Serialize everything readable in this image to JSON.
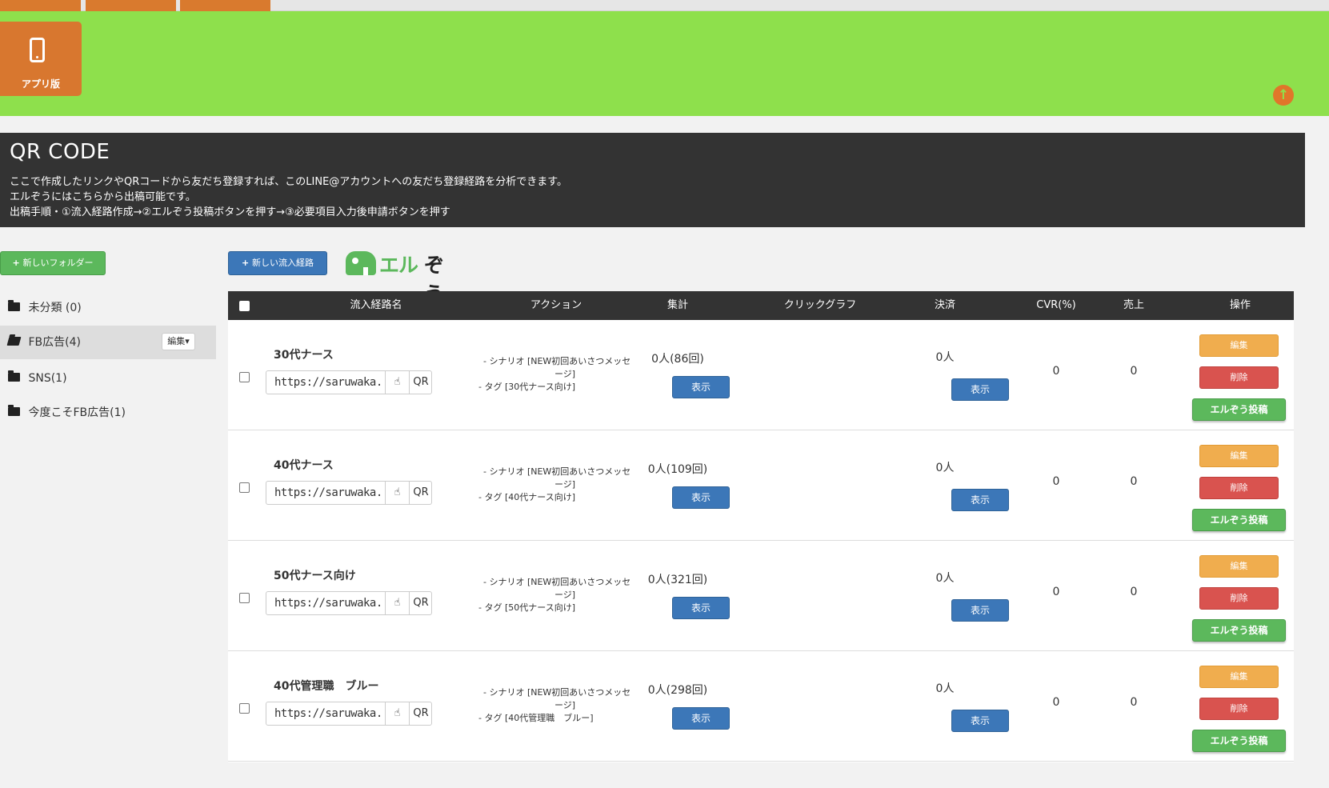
{
  "app": {
    "app_button_label": "アプリ版",
    "icons": {
      "phone": "phone-icon",
      "up": "arrow-up-circle-icon",
      "plus": "plus-icon",
      "folder": "folder-icon",
      "copy": "hand-pointer-icon"
    }
  },
  "header": {
    "title": "QR CODE",
    "desc1": "ここで作成したリンクやQRコードから友だち登録すれば、このLINE@アカウントへの友だち登録経路を分析できます。",
    "desc2": "エルぞうにはこちらから出稿可能です。",
    "desc3": "出稿手順・①流入経路作成→②エルぞう投稿ボタンを押す→③必要項目入力後申請ボタンを押す"
  },
  "sidebar": {
    "new_folder": "新しいフォルダー",
    "folders": [
      {
        "label": "未分類 (0)"
      },
      {
        "label": "FB広告(4)",
        "edit": "編集▾"
      },
      {
        "label": "SNS(1)"
      },
      {
        "label": "今度こそFB広告(1)"
      }
    ]
  },
  "toolbar": {
    "new_route": "新しい流入経路",
    "logo_part1": "エル",
    "logo_part2": "ぞう"
  },
  "table": {
    "columns": [
      "流入経路名",
      "アクション",
      "集計",
      "クリックグラフ",
      "決済",
      "CVR(%)",
      "売上",
      "操作"
    ],
    "url_value": "https://saruwaka.jp",
    "qr_label": "QR",
    "show_label": "表示",
    "edit_label": "編集",
    "delete_label": "削除",
    "post_label": "エルぞう投稿",
    "rows": [
      {
        "name": "30代ナース",
        "scenario_a": "- シナリオ [NEW初回あいさつメッセ",
        "scenario_b": "ージ]",
        "tag": "- タグ [30代ナース向け]",
        "count": "0人(86回)",
        "pay": "0人",
        "cvr": "0",
        "sales": "0"
      },
      {
        "name": "40代ナース",
        "scenario_a": "- シナリオ [NEW初回あいさつメッセ",
        "scenario_b": "ージ]",
        "tag": "- タグ [40代ナース向け]",
        "count": "0人(109回)",
        "pay": "0人",
        "cvr": "0",
        "sales": "0"
      },
      {
        "name": "50代ナース向け",
        "scenario_a": "- シナリオ [NEW初回あいさつメッセ",
        "scenario_b": "ージ]",
        "tag": "- タグ [50代ナース向け]",
        "count": "0人(321回)",
        "pay": "0人",
        "cvr": "0",
        "sales": "0"
      },
      {
        "name": "40代管理職　ブルー",
        "scenario_a": "- シナリオ [NEW初回あいさつメッセ",
        "scenario_b": "ージ]",
        "tag": "- タグ [40代管理職　ブルー]",
        "count": "0人(298回)",
        "pay": "0人",
        "cvr": "0",
        "sales": "0"
      }
    ]
  },
  "colors": {
    "green_bar": "#8ee04c",
    "orange": "#d8772f",
    "dark": "#333333",
    "blue": "#3c77b8",
    "red": "#d9534f",
    "yellow": "#f0ad4e",
    "post_green": "#5cb85c"
  }
}
